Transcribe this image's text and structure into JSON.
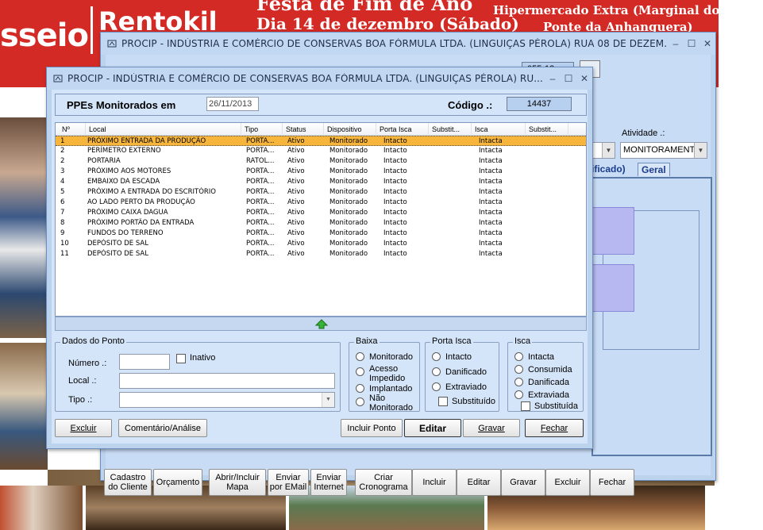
{
  "background_page": {
    "logo_left": "sseio",
    "logo_right": "Rentokil",
    "event_line1": "Festa de Fim de Ano",
    "event_line2": "Dia 14 de dezembro (Sábado)",
    "venue_line1": "Hipermercado Extra (Marginal do Tiête/",
    "venue_line2": "Ponte da Anhanguera)"
  },
  "back_window": {
    "title": "PROCIP - INDÚSTRIA E COMÉRCIO DE CONSERVAS BOA FÓRMULA LTDA. (LINGUIÇAS PÉROLA)  RUA 08 DE DEZEM...",
    "code_value": "055-13",
    "atividade_label": "Atividade .:",
    "atividade_value": "MONITORAMENT",
    "tab_partial": "ificado)",
    "tab_geral": "Geral",
    "buttons": {
      "cadastro": "Cadastro do Cliente",
      "orcamento": "Orçamento",
      "abrir_mapa": "Abrir/Incluir Mapa",
      "enviar_email": "Enviar por EMail",
      "enviar_internet": "Enviar Internet",
      "criar_cronograma": "Criar Cronograma",
      "incluir": "Incluir",
      "editar": "Editar",
      "gravar": "Gravar",
      "excluir": "Excluir",
      "fechar": "Fechar"
    }
  },
  "front_window": {
    "title": "PROCIP - INDÚSTRIA E COMÉRCIO DE CONSERVAS BOA FÓRMULA LTDA. (LINGUIÇAS PÉROLA)  RU...",
    "header": {
      "title": "PPEs Monitorados em",
      "date": "26/11/2013",
      "code_label": "Código .:",
      "code_value": "14437"
    },
    "columns": [
      "Nº",
      "Local",
      "Tipo",
      "Status",
      "Dispositivo",
      "Porta Isca",
      "Substit...",
      "Isca",
      "Substit..."
    ],
    "rows": [
      {
        "n": "1",
        "local": "PRÓXIMO ENTRADA DA PRODUÇÃO",
        "tipo": "PORTA...",
        "status": "Ativo",
        "dispositivo": "Monitorado",
        "porta": "Intacto",
        "sub1": "",
        "isca": "Intacta",
        "sub2": ""
      },
      {
        "n": "2",
        "local": "PERÍMETRO EXTERNO",
        "tipo": "PORTA...",
        "status": "Ativo",
        "dispositivo": "Monitorado",
        "porta": "Intacto",
        "sub1": "",
        "isca": "Intacta",
        "sub2": ""
      },
      {
        "n": "2",
        "local": "PORTARIA",
        "tipo": "RATOL...",
        "status": "Ativo",
        "dispositivo": "Monitorado",
        "porta": "Intacto",
        "sub1": "",
        "isca": "Intacta",
        "sub2": ""
      },
      {
        "n": "3",
        "local": "PRÓXIMO AOS MOTORES",
        "tipo": "PORTA...",
        "status": "Ativo",
        "dispositivo": "Monitorado",
        "porta": "Intacto",
        "sub1": "",
        "isca": "Intacta",
        "sub2": ""
      },
      {
        "n": "4",
        "local": "EMBAIXO DA ESCADA",
        "tipo": "PORTA...",
        "status": "Ativo",
        "dispositivo": "Monitorado",
        "porta": "Intacto",
        "sub1": "",
        "isca": "Intacta",
        "sub2": ""
      },
      {
        "n": "5",
        "local": "PRÓXIMO A ENTRADA DO ESCRITÓRIO",
        "tipo": "PORTA...",
        "status": "Ativo",
        "dispositivo": "Monitorado",
        "porta": "Intacto",
        "sub1": "",
        "isca": "Intacta",
        "sub2": ""
      },
      {
        "n": "6",
        "local": "AO LADO PERTO DA PRODUÇÃO",
        "tipo": "PORTA...",
        "status": "Ativo",
        "dispositivo": "Monitorado",
        "porta": "Intacto",
        "sub1": "",
        "isca": "Intacta",
        "sub2": ""
      },
      {
        "n": "7",
        "local": "PRÓXIMO CAIXA DAGUA",
        "tipo": "PORTA...",
        "status": "Ativo",
        "dispositivo": "Monitorado",
        "porta": "Intacto",
        "sub1": "",
        "isca": "Intacta",
        "sub2": ""
      },
      {
        "n": "8",
        "local": "PRÓXIMO PORTÃO DA ENTRADA",
        "tipo": "PORTA...",
        "status": "Ativo",
        "dispositivo": "Monitorado",
        "porta": "Intacto",
        "sub1": "",
        "isca": "Intacta",
        "sub2": ""
      },
      {
        "n": "9",
        "local": "FUNDOS DO TERRENO",
        "tipo": "PORTA...",
        "status": "Ativo",
        "dispositivo": "Monitorado",
        "porta": "Intacto",
        "sub1": "",
        "isca": "Intacta",
        "sub2": ""
      },
      {
        "n": "10",
        "local": "DEPÓSITO DE SAL",
        "tipo": "PORTA...",
        "status": "Ativo",
        "dispositivo": "Monitorado",
        "porta": "Intacto",
        "sub1": "",
        "isca": "Intacta",
        "sub2": ""
      },
      {
        "n": "11",
        "local": "DEPÓSITO DE SAL",
        "tipo": "PORTA...",
        "status": "Ativo",
        "dispositivo": "Monitorado",
        "porta": "Intacto",
        "sub1": "",
        "isca": "Intacta",
        "sub2": ""
      }
    ],
    "dados": {
      "group_title": "Dados do Ponto",
      "numero_label": "Número .:",
      "numero_value": "",
      "inativo_label": "Inativo",
      "local_label": "Local .:",
      "local_value": "",
      "tipo_label": "Tipo .:",
      "tipo_value": ""
    },
    "baixa": {
      "title": "Baixa",
      "options": [
        "Monitorado",
        "Acesso Impedido",
        "Implantado",
        "Não Monitorado"
      ]
    },
    "porta_isca": {
      "title": "Porta Isca",
      "options": [
        "Intacto",
        "Danificado",
        "Extraviado"
      ],
      "substituido_label": "Substituído"
    },
    "isca": {
      "title": "Isca",
      "options": [
        "Intacta",
        "Consumida",
        "Danificada",
        "Extraviada"
      ],
      "substituida_label": "Substituída"
    },
    "buttons": {
      "excluir": "Excluir",
      "comentario": "Comentário/Análise",
      "incluir_ponto": "Incluir Ponto",
      "editar": "Editar",
      "gravar": "Gravar",
      "fechar": "Fechar"
    }
  }
}
